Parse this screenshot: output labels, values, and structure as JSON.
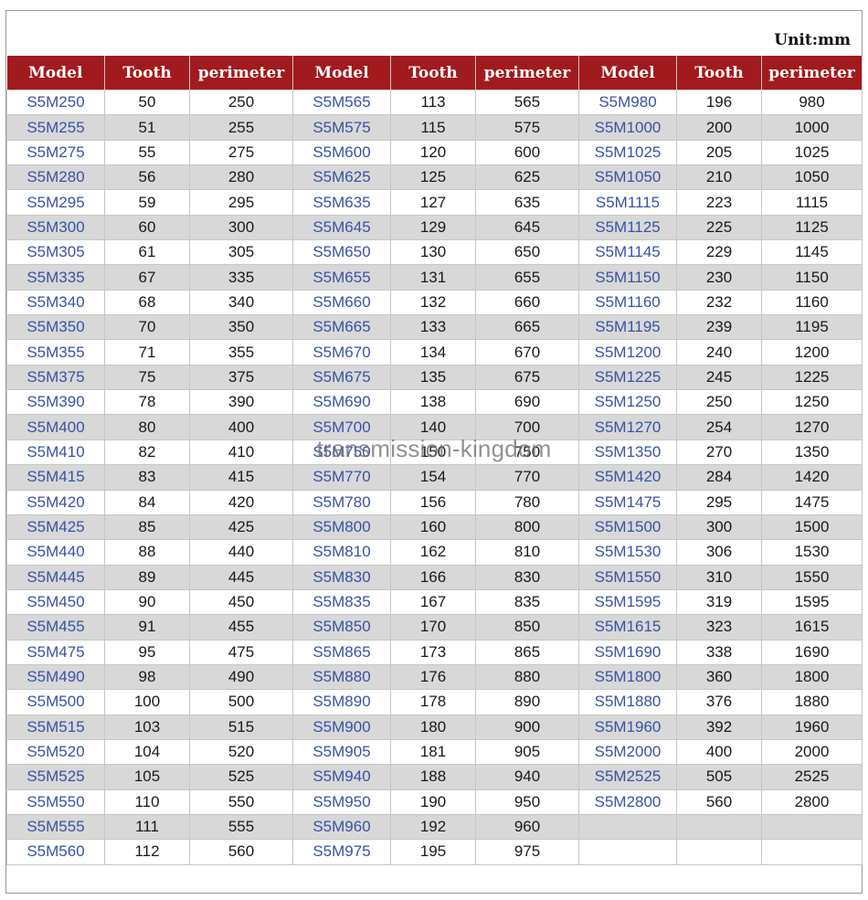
{
  "unit_label": "Unit:mm",
  "watermark": "transmission-kingdom",
  "headers": [
    "Model",
    "Tooth",
    "perimeter",
    "Model",
    "Tooth",
    "perimeter",
    "Model",
    "Tooth",
    "perimeter"
  ],
  "rows": [
    [
      "S5M250",
      "50",
      "250",
      "S5M565",
      "113",
      "565",
      "S5M980",
      "196",
      "980"
    ],
    [
      "S5M255",
      "51",
      "255",
      "S5M575",
      "115",
      "575",
      "S5M1000",
      "200",
      "1000"
    ],
    [
      "S5M275",
      "55",
      "275",
      "S5M600",
      "120",
      "600",
      "S5M1025",
      "205",
      "1025"
    ],
    [
      "S5M280",
      "56",
      "280",
      "S5M625",
      "125",
      "625",
      "S5M1050",
      "210",
      "1050"
    ],
    [
      "S5M295",
      "59",
      "295",
      "S5M635",
      "127",
      "635",
      "S5M1115",
      "223",
      "1115"
    ],
    [
      "S5M300",
      "60",
      "300",
      "S5M645",
      "129",
      "645",
      "S5M1125",
      "225",
      "1125"
    ],
    [
      "S5M305",
      "61",
      "305",
      "S5M650",
      "130",
      "650",
      "S5M1145",
      "229",
      "1145"
    ],
    [
      "S5M335",
      "67",
      "335",
      "S5M655",
      "131",
      "655",
      "S5M1150",
      "230",
      "1150"
    ],
    [
      "S5M340",
      "68",
      "340",
      "S5M660",
      "132",
      "660",
      "S5M1160",
      "232",
      "1160"
    ],
    [
      "S5M350",
      "70",
      "350",
      "S5M665",
      "133",
      "665",
      "S5M1195",
      "239",
      "1195"
    ],
    [
      "S5M355",
      "71",
      "355",
      "S5M670",
      "134",
      "670",
      "S5M1200",
      "240",
      "1200"
    ],
    [
      "S5M375",
      "75",
      "375",
      "S5M675",
      "135",
      "675",
      "S5M1225",
      "245",
      "1225"
    ],
    [
      "S5M390",
      "78",
      "390",
      "S5M690",
      "138",
      "690",
      "S5M1250",
      "250",
      "1250"
    ],
    [
      "S5M400",
      "80",
      "400",
      "S5M700",
      "140",
      "700",
      "S5M1270",
      "254",
      "1270"
    ],
    [
      "S5M410",
      "82",
      "410",
      "S5M750",
      "150",
      "750",
      "S5M1350",
      "270",
      "1350"
    ],
    [
      "S5M415",
      "83",
      "415",
      "S5M770",
      "154",
      "770",
      "S5M1420",
      "284",
      "1420"
    ],
    [
      "S5M420",
      "84",
      "420",
      "S5M780",
      "156",
      "780",
      "S5M1475",
      "295",
      "1475"
    ],
    [
      "S5M425",
      "85",
      "425",
      "S5M800",
      "160",
      "800",
      "S5M1500",
      "300",
      "1500"
    ],
    [
      "S5M440",
      "88",
      "440",
      "S5M810",
      "162",
      "810",
      "S5M1530",
      "306",
      "1530"
    ],
    [
      "S5M445",
      "89",
      "445",
      "S5M830",
      "166",
      "830",
      "S5M1550",
      "310",
      "1550"
    ],
    [
      "S5M450",
      "90",
      "450",
      "S5M835",
      "167",
      "835",
      "S5M1595",
      "319",
      "1595"
    ],
    [
      "S5M455",
      "91",
      "455",
      "S5M850",
      "170",
      "850",
      "S5M1615",
      "323",
      "1615"
    ],
    [
      "S5M475",
      "95",
      "475",
      "S5M865",
      "173",
      "865",
      "S5M1690",
      "338",
      "1690"
    ],
    [
      "S5M490",
      "98",
      "490",
      "S5M880",
      "176",
      "880",
      "S5M1800",
      "360",
      "1800"
    ],
    [
      "S5M500",
      "100",
      "500",
      "S5M890",
      "178",
      "890",
      "S5M1880",
      "376",
      "1880"
    ],
    [
      "S5M515",
      "103",
      "515",
      "S5M900",
      "180",
      "900",
      "S5M1960",
      "392",
      "1960"
    ],
    [
      "S5M520",
      "104",
      "520",
      "S5M905",
      "181",
      "905",
      "S5M2000",
      "400",
      "2000"
    ],
    [
      "S5M525",
      "105",
      "525",
      "S5M940",
      "188",
      "940",
      "S5M2525",
      "505",
      "2525"
    ],
    [
      "S5M550",
      "110",
      "550",
      "S5M950",
      "190",
      "950",
      "S5M2800",
      "560",
      "2800"
    ],
    [
      "S5M555",
      "111",
      "555",
      "S5M960",
      "192",
      "960",
      "",
      "",
      ""
    ],
    [
      "S5M560",
      "112",
      "560",
      "S5M975",
      "195",
      "975",
      "",
      "",
      ""
    ]
  ]
}
